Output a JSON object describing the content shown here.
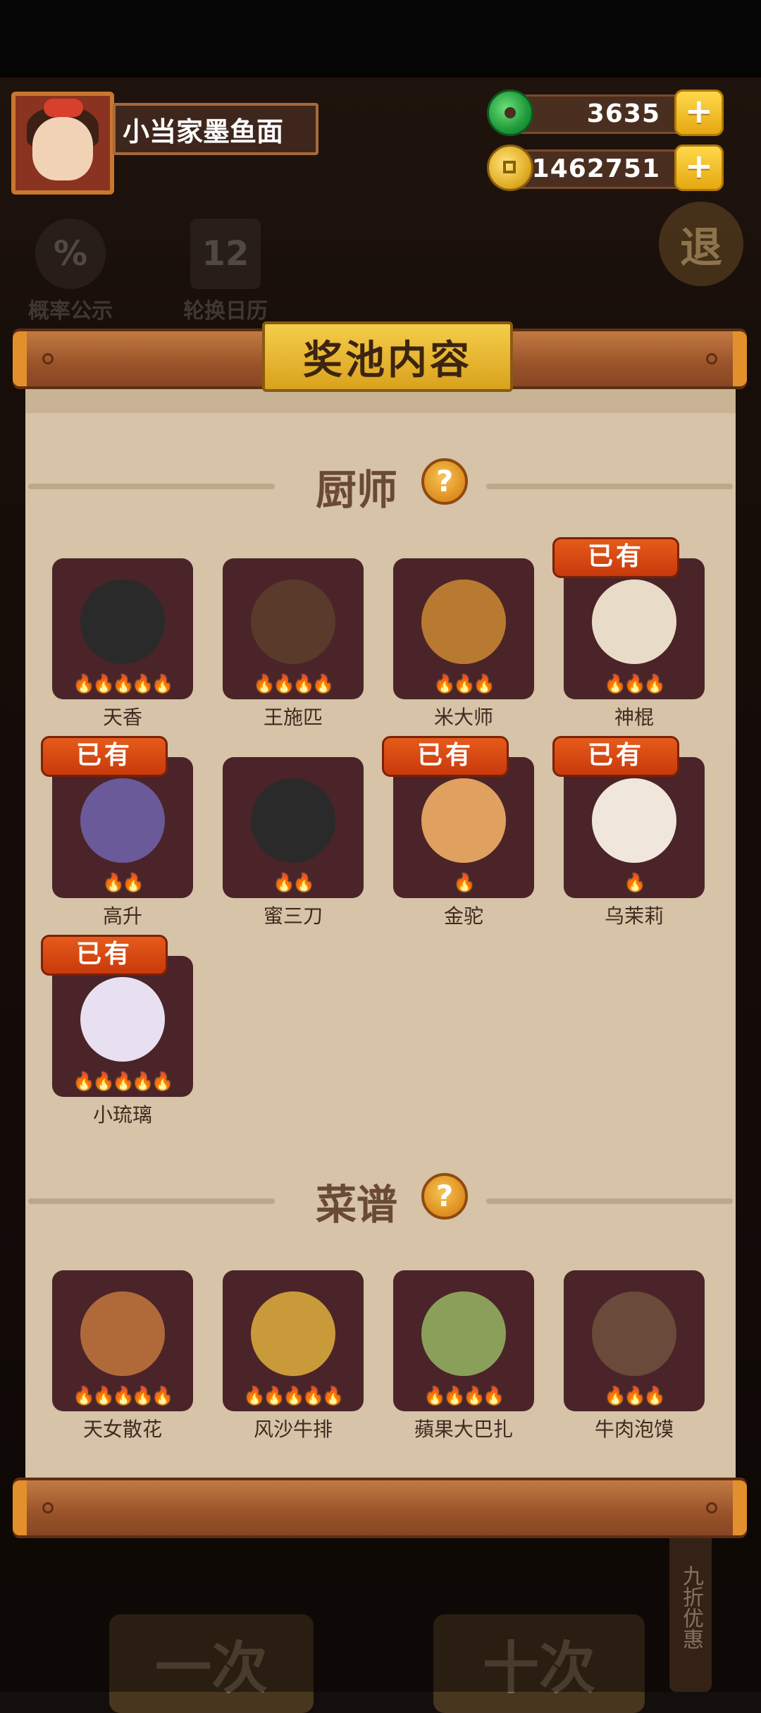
{
  "hud": {
    "player_name": "小当家墨鱼面",
    "jade_amount": "3635",
    "coin_amount": "1462751",
    "plus": "+"
  },
  "background": {
    "probability_label": "概率公示",
    "calendar_label": "轮换日历",
    "exit_label": "退",
    "draw_one": "一次",
    "draw_ten": "十次",
    "discount": "九折优惠",
    "percent_icon_text": "%",
    "calendar_icon_text": "12"
  },
  "panel": {
    "title": "奖池内容",
    "chefs_title": "厨师",
    "recipes_title": "菜谱",
    "help_glyph": "?",
    "owned_badge": "已有"
  },
  "chefs": [
    {
      "name": "天香",
      "stars": 5,
      "owned": false,
      "color": "#2a2a2a"
    },
    {
      "name": "王施匹",
      "stars": 4,
      "owned": false,
      "color": "#5a3a2a"
    },
    {
      "name": "米大师",
      "stars": 3,
      "owned": false,
      "color": "#b87a30"
    },
    {
      "name": "神棍",
      "stars": 3,
      "owned": true,
      "color": "#e8dcc8"
    },
    {
      "name": "高升",
      "stars": 2,
      "owned": true,
      "color": "#6a5a9a"
    },
    {
      "name": "蜜三刀",
      "stars": 2,
      "owned": false,
      "color": "#2a2a2a"
    },
    {
      "name": "金驼",
      "stars": 1,
      "owned": true,
      "color": "#e0a060"
    },
    {
      "name": "乌茉莉",
      "stars": 1,
      "owned": true,
      "color": "#f0e6dc"
    },
    {
      "name": "小琉璃",
      "stars": 5,
      "owned": true,
      "color": "#e8e0f0"
    }
  ],
  "recipes": [
    {
      "name": "天女散花",
      "stars": 5,
      "color": "#b06a3a"
    },
    {
      "name": "风沙牛排",
      "stars": 5,
      "color": "#c89a3a"
    },
    {
      "name": "蘋果大巴扎",
      "stars": 4,
      "color": "#8aa05a"
    },
    {
      "name": "牛肉泡馍",
      "stars": 3,
      "color": "#6a4a3a"
    }
  ]
}
